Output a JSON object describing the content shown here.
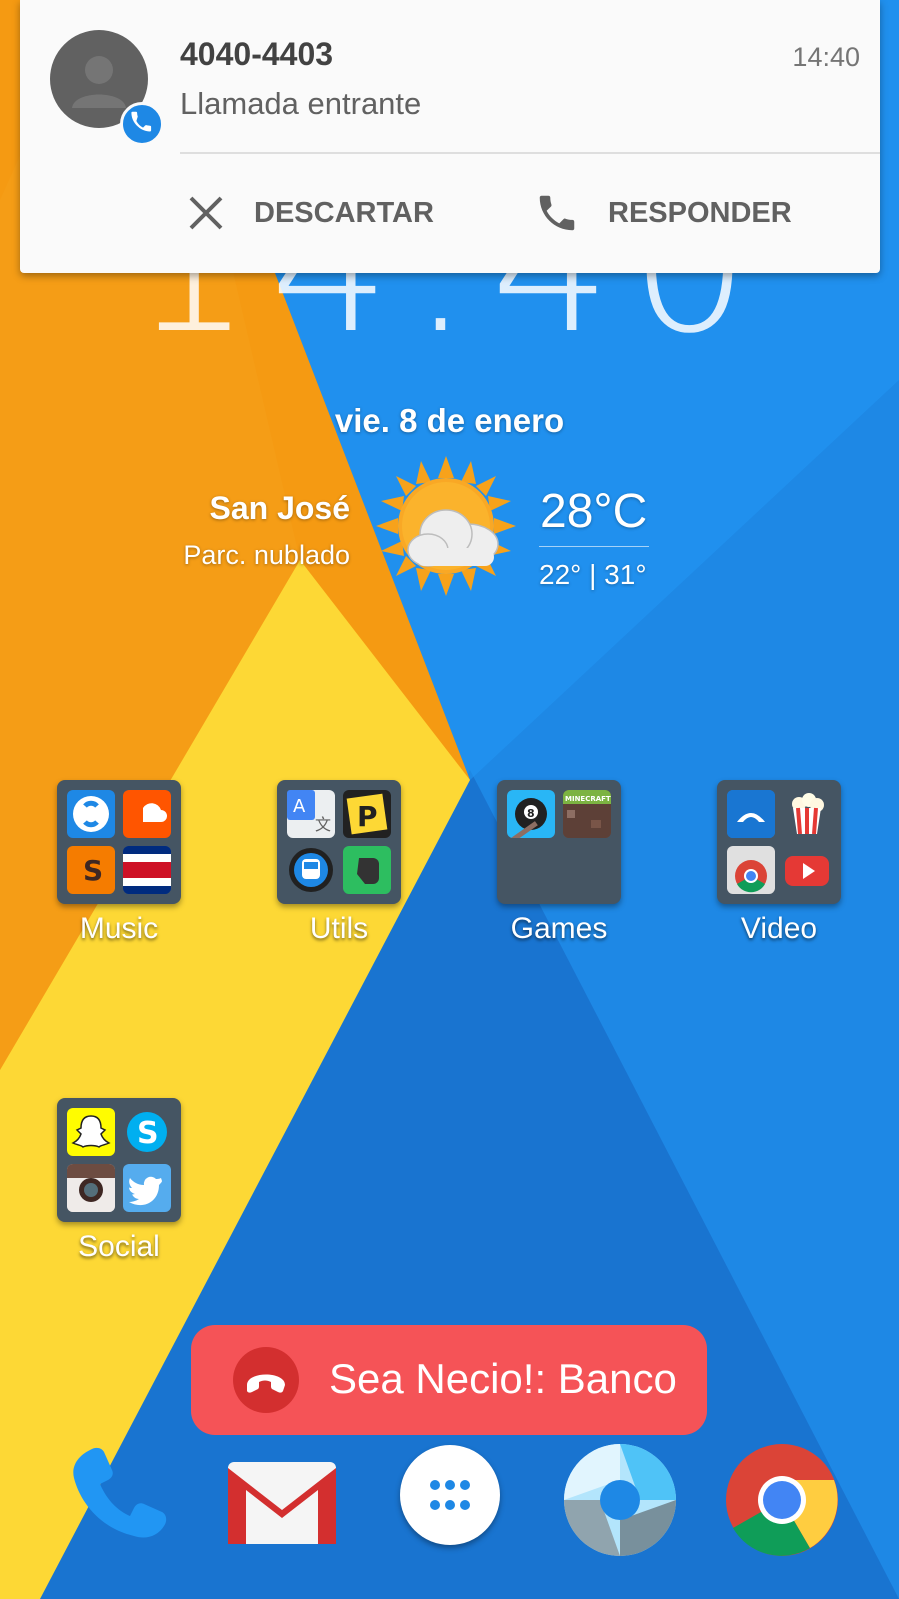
{
  "clock": {
    "time": "14:40"
  },
  "widget": {
    "date": "vie. 8 de enero",
    "city": "San José",
    "condition": "Parc. nublado",
    "temp": "28°C",
    "range": "22° | 31°",
    "icon": "partly-cloudy-icon"
  },
  "notification": {
    "number": "4040-4403",
    "subtitle": "Llamada entrante",
    "time": "14:40",
    "dismiss": "DESCARTAR",
    "answer": "RESPONDER"
  },
  "folders": [
    {
      "label": "Music",
      "apps": [
        "shazam-icon",
        "soundcloud-icon",
        "soundhound-icon",
        "costa-rica-flag-icon"
      ]
    },
    {
      "label": "Utils",
      "apps": [
        "translate-icon",
        "picsart-icon",
        "bus-icon",
        "evernote-icon"
      ]
    },
    {
      "label": "Games",
      "apps": [
        "8-ball-pool-icon",
        "minecraft-icon"
      ]
    },
    {
      "label": "Video",
      "apps": [
        "cast-icon",
        "popcorn-icon",
        "chrome-icon",
        "youtube-icon"
      ]
    },
    {
      "label": "Social",
      "apps": [
        "snapchat-icon",
        "skype-icon",
        "instagram-icon",
        "twitter-icon"
      ]
    }
  ],
  "toast": {
    "text": "Sea Necio!: Banco"
  },
  "dock": [
    "phone-icon",
    "gmail-icon",
    "app-drawer-icon",
    "camera-icon",
    "chrome-icon"
  ],
  "colors": {
    "wallpaper_orange": "#f59a12",
    "wallpaper_yellow": "#fdd835",
    "wallpaper_blue": "#1e88e5",
    "toast": "#f55357",
    "badge": "#1e88e5"
  }
}
